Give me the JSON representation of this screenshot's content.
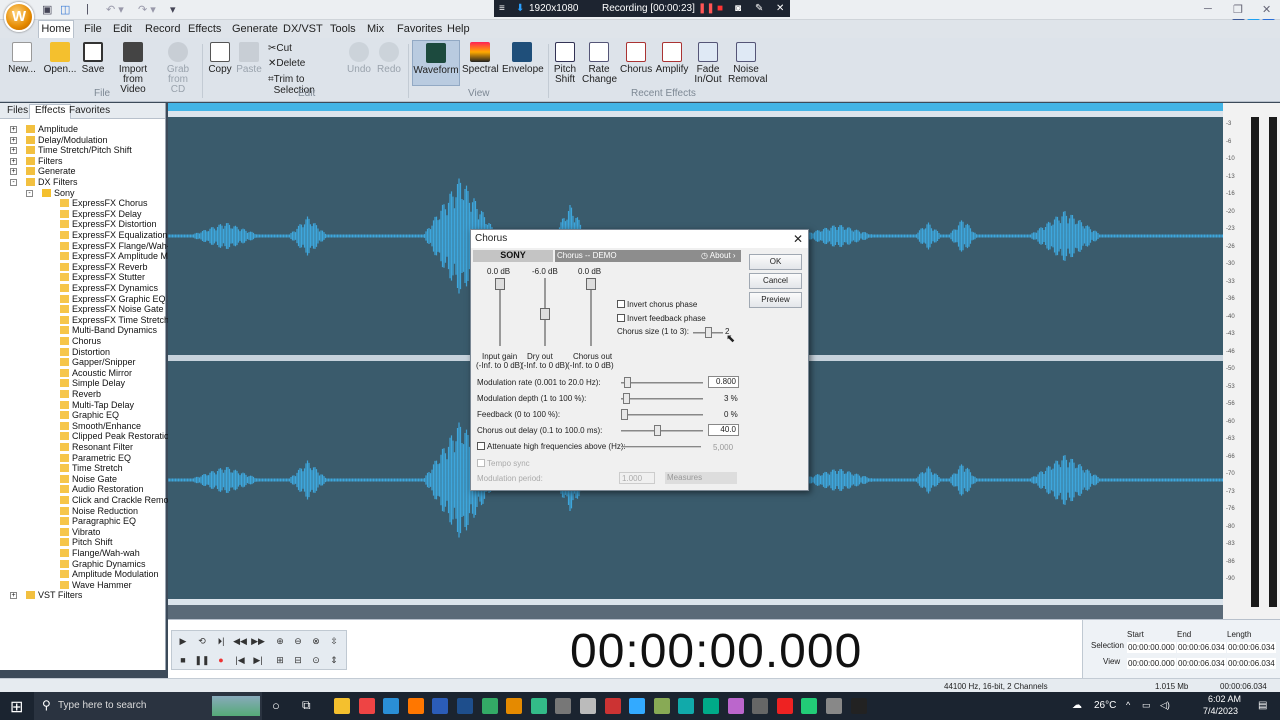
{
  "titlebar": {
    "logo_letter": "W"
  },
  "recording": {
    "resolution": "1920x1080",
    "status": "Recording [00:00:23]"
  },
  "menu": [
    "Home",
    "File",
    "Edit",
    "Record",
    "Effects",
    "Generate",
    "DX/VST",
    "Tools",
    "Mix",
    "Favorites",
    "Help"
  ],
  "ribbon": {
    "file": [
      {
        "l1": "New...",
        "l2": ""
      },
      {
        "l1": "Open...",
        "l2": ""
      },
      {
        "l1": "Save",
        "l2": ""
      },
      {
        "l1": "Import",
        "l2": "from Video"
      },
      {
        "l1": "Grab",
        "l2": "from CD"
      }
    ],
    "file_label": "File",
    "copy": "Copy",
    "paste": "Paste",
    "cut": "Cut",
    "delete": "Delete",
    "trim": "Trim to Selection",
    "undo": "Undo",
    "redo": "Redo",
    "edit_label": "Edit",
    "view": [
      {
        "l1": "Waveform"
      },
      {
        "l1": "Spectral"
      },
      {
        "l1": "Envelope"
      }
    ],
    "view_label": "View",
    "effects": [
      {
        "l1": "Pitch",
        "l2": "Shift"
      },
      {
        "l1": "Rate",
        "l2": "Change"
      },
      {
        "l1": "Chorus",
        "l2": ""
      },
      {
        "l1": "Amplify",
        "l2": ""
      },
      {
        "l1": "Fade",
        "l2": "In/Out"
      },
      {
        "l1": "Noise",
        "l2": "Removal"
      }
    ],
    "effects_label": "Recent Effects"
  },
  "panel_tabs": [
    "Files",
    "Effects",
    "Favorites"
  ],
  "tree": [
    {
      "label": "Amplitude",
      "lvl": 0,
      "exp": "+"
    },
    {
      "label": "Delay/Modulation",
      "lvl": 0,
      "exp": "+"
    },
    {
      "label": "Time Stretch/Pitch Shift",
      "lvl": 0,
      "exp": "+"
    },
    {
      "label": "Filters",
      "lvl": 0,
      "exp": "+"
    },
    {
      "label": "Generate",
      "lvl": 0,
      "exp": "+"
    },
    {
      "label": "DX Filters",
      "lvl": 0,
      "exp": "-"
    },
    {
      "label": "Sony",
      "lvl": 1,
      "exp": "-"
    },
    {
      "label": "ExpressFX Chorus",
      "lvl": 2
    },
    {
      "label": "ExpressFX Delay",
      "lvl": 2
    },
    {
      "label": "ExpressFX Distortion",
      "lvl": 2
    },
    {
      "label": "ExpressFX Equalization",
      "lvl": 2
    },
    {
      "label": "ExpressFX Flange/Wah-Wa",
      "lvl": 2
    },
    {
      "label": "ExpressFX Amplitude Modu",
      "lvl": 2
    },
    {
      "label": "ExpressFX Reverb",
      "lvl": 2
    },
    {
      "label": "ExpressFX Stutter",
      "lvl": 2
    },
    {
      "label": "ExpressFX Dynamics",
      "lvl": 2
    },
    {
      "label": "ExpressFX Graphic EQ",
      "lvl": 2
    },
    {
      "label": "ExpressFX Noise Gate",
      "lvl": 2
    },
    {
      "label": "ExpressFX Time Stretch",
      "lvl": 2
    },
    {
      "label": "Multi-Band Dynamics",
      "lvl": 2
    },
    {
      "label": "Chorus",
      "lvl": 2
    },
    {
      "label": "Distortion",
      "lvl": 2
    },
    {
      "label": "Gapper/Snipper",
      "lvl": 2
    },
    {
      "label": "Acoustic Mirror",
      "lvl": 2
    },
    {
      "label": "Simple Delay",
      "lvl": 2
    },
    {
      "label": "Reverb",
      "lvl": 2
    },
    {
      "label": "Multi-Tap Delay",
      "lvl": 2
    },
    {
      "label": "Graphic EQ",
      "lvl": 2
    },
    {
      "label": "Smooth/Enhance",
      "lvl": 2
    },
    {
      "label": "Clipped Peak Restoration",
      "lvl": 2
    },
    {
      "label": "Resonant Filter",
      "lvl": 2
    },
    {
      "label": "Parametric EQ",
      "lvl": 2
    },
    {
      "label": "Time Stretch",
      "lvl": 2
    },
    {
      "label": "Noise Gate",
      "lvl": 2
    },
    {
      "label": "Audio Restoration",
      "lvl": 2
    },
    {
      "label": "Click and Crackle Removal",
      "lvl": 2
    },
    {
      "label": "Noise Reduction",
      "lvl": 2
    },
    {
      "label": "Paragraphic EQ",
      "lvl": 2
    },
    {
      "label": "Vibrato",
      "lvl": 2
    },
    {
      "label": "Pitch Shift",
      "lvl": 2
    },
    {
      "label": "Flange/Wah-wah",
      "lvl": 2
    },
    {
      "label": "Graphic Dynamics",
      "lvl": 2
    },
    {
      "label": "Amplitude Modulation",
      "lvl": 2
    },
    {
      "label": "Wave Hammer",
      "lvl": 2
    },
    {
      "label": "VST Filters",
      "lvl": 0,
      "exp": "+"
    }
  ],
  "meter_scale": [
    "-3",
    "-6",
    "-10",
    "-13",
    "-16",
    "-20",
    "-23",
    "-26",
    "-30",
    "-33",
    "-36",
    "-40",
    "-43",
    "-46",
    "-50",
    "-53",
    "-56",
    "-60",
    "-63",
    "-66",
    "-70",
    "-73",
    "-76",
    "-80",
    "-83",
    "-86",
    "-90"
  ],
  "dialog": {
    "title": "Chorus",
    "brand": "SONY",
    "preset": "Chorus -- DEMO",
    "about": "About",
    "sliders_top": [
      {
        "val": "0.0 dB",
        "name": "Input gain",
        "range": "(-Inf. to 0 dB)",
        "level": 1.0
      },
      {
        "val": "-6.0 dB",
        "name": "Dry out",
        "range": "(-Inf. to 0 dB)",
        "level": 0.5
      },
      {
        "val": "0.0 dB",
        "name": "Chorus out",
        "range": "(-Inf. to 0 dB)",
        "level": 1.0
      }
    ],
    "invert_chorus": "Invert chorus phase",
    "invert_feedback": "Invert feedback phase",
    "chorus_size": "Chorus size (1 to 3):",
    "chorus_size_value": "2",
    "rows": [
      {
        "label": "Modulation rate (0.001 to 20.0 Hz):",
        "value": "0.800",
        "box": true,
        "pos": 0.04
      },
      {
        "label": "Modulation depth (1 to 100 %):",
        "value": "3 %",
        "box": false,
        "pos": 0.02
      },
      {
        "label": "Feedback (0 to 100 %):",
        "value": "0 %",
        "box": false,
        "pos": 0.0
      },
      {
        "label": "Chorus out delay (0.1 to 100.0 ms):",
        "value": "40.0",
        "box": true,
        "pos": 0.4
      }
    ],
    "attenuate": "Attenuate high frequencies above (Hz):",
    "attenuate_value": "5,000",
    "tempo_sync": "Tempo sync",
    "mod_period": "Modulation period:",
    "mod_period_value": "1.000",
    "measures": "Measures",
    "ok": "OK",
    "cancel": "Cancel",
    "preview": "Preview"
  },
  "time_display": "00:00:00.000",
  "sel": {
    "h_start": "Start",
    "h_end": "End",
    "h_len": "Length",
    "sel_label": "Selection",
    "view_label": "View",
    "sel_start": "00:00:00.000",
    "sel_end": "00:00:06.034",
    "sel_len": "00:00:06.034",
    "view_start": "00:00:00.000",
    "view_end": "00:00:06.034",
    "view_len": "00:00:06.034"
  },
  "status": {
    "format": "44100 Hz, 16-bit, 2 Channels",
    "size": "1.015 Mb",
    "duration": "00:00:06.034"
  },
  "taskbar": {
    "search": "Type here to search",
    "temp": "26°C",
    "time": "6:02 AM",
    "date": "7/4/2023"
  }
}
